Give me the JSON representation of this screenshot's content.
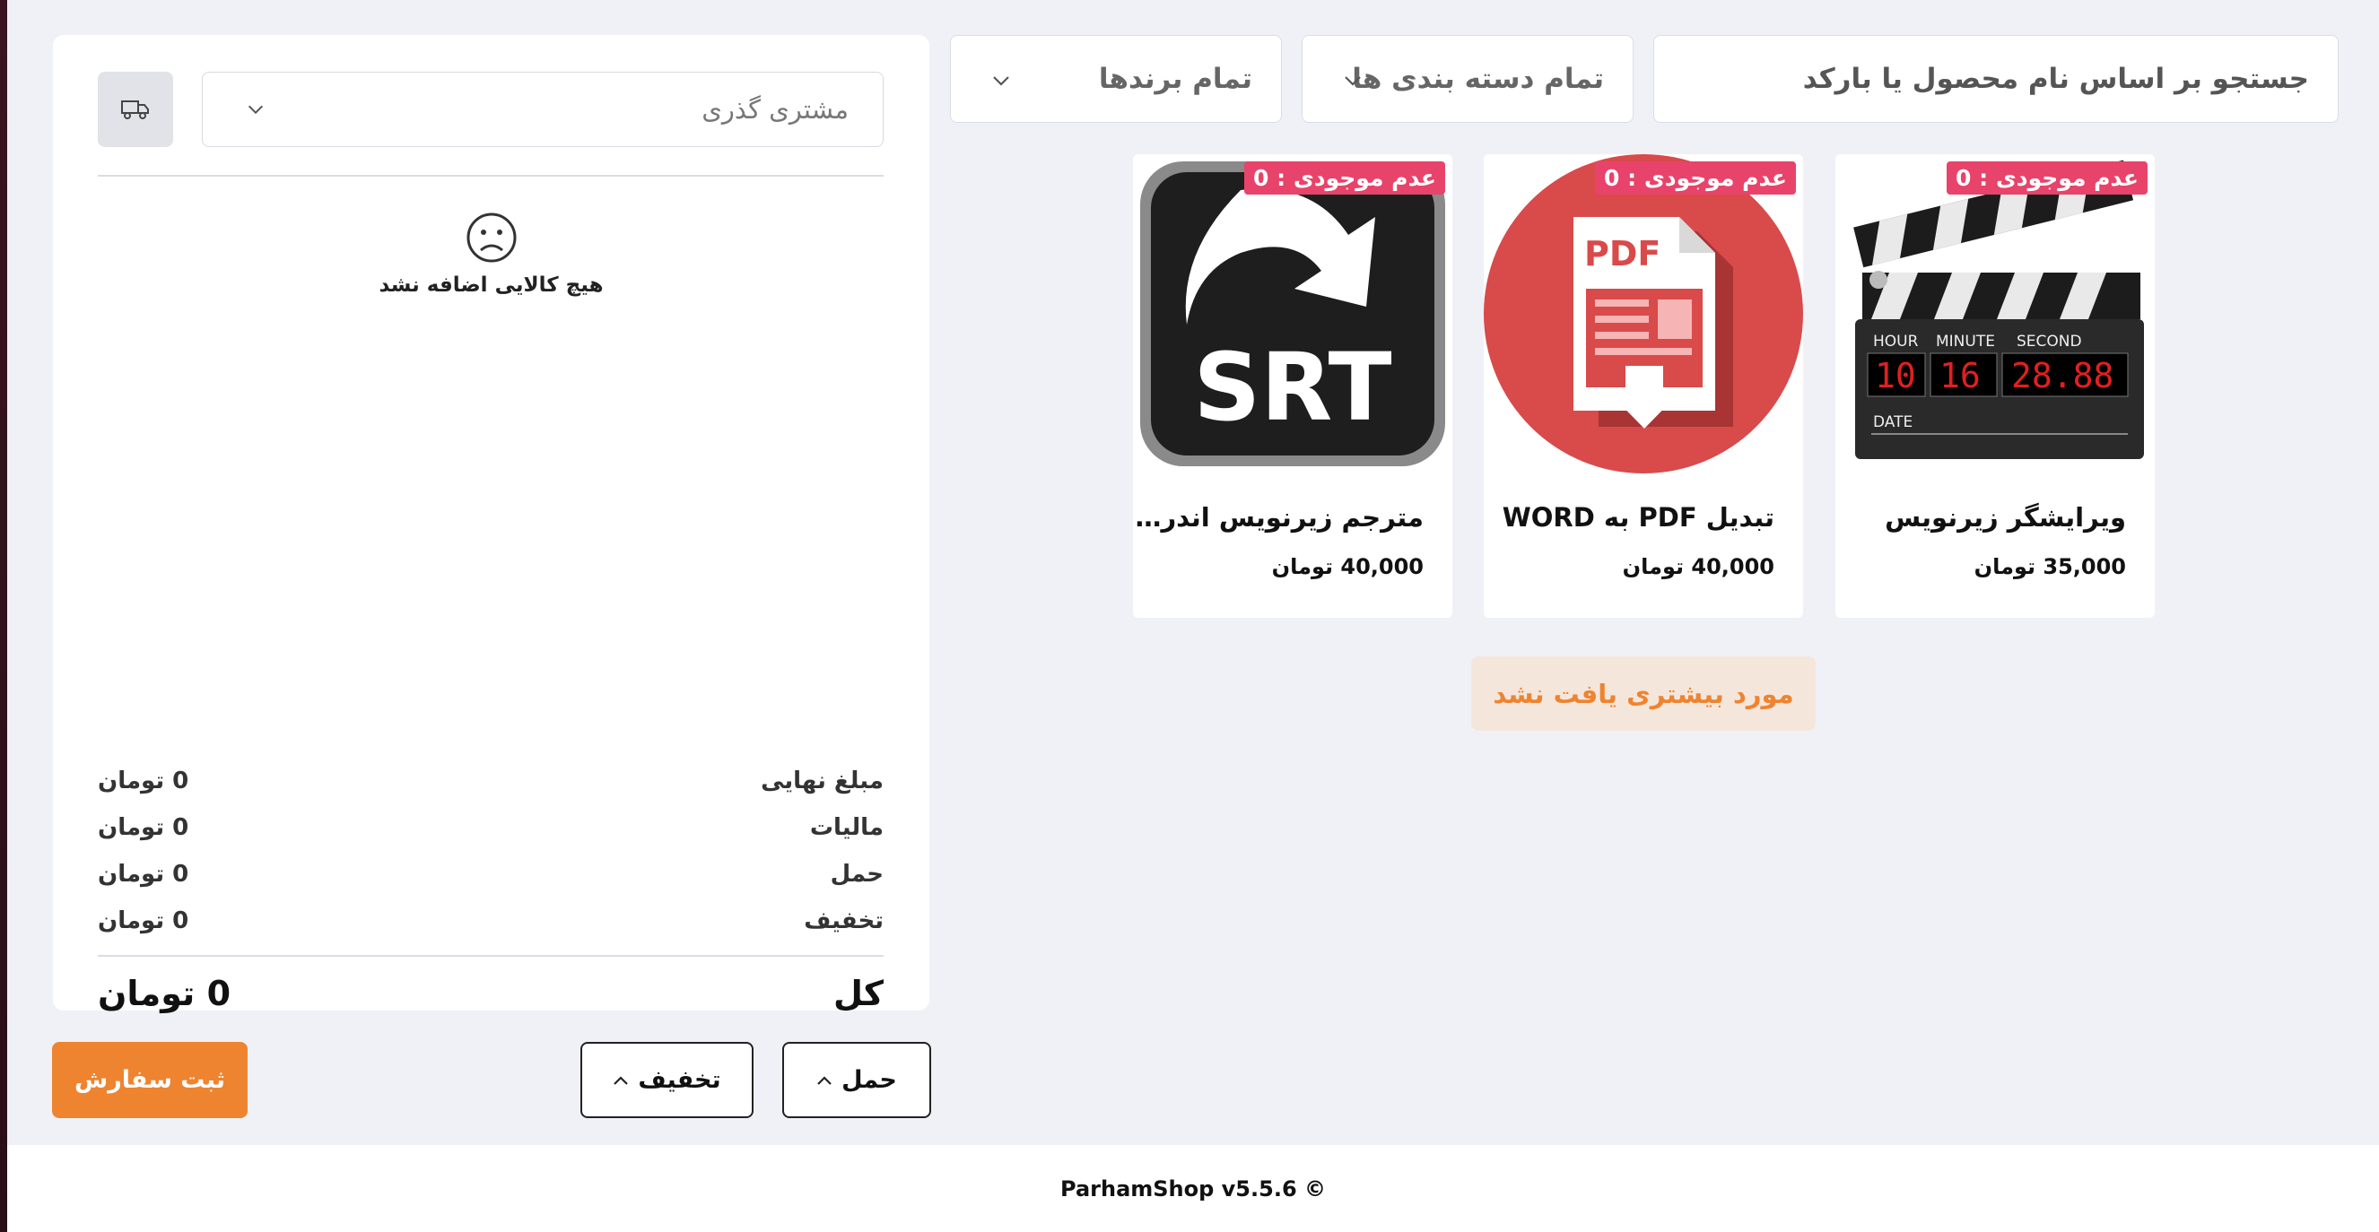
{
  "filters": {
    "search_placeholder": "جستجو بر اساس نام محصول یا بارکد",
    "category": "تمام دسته بندی ها",
    "brand": "تمام برندها"
  },
  "products": [
    {
      "name": "ویرایشگر زیرنویس",
      "price": "35,000 تومان",
      "badge": "عدم موجودی : 0",
      "icon": "clapperboard-icon"
    },
    {
      "name": "تبدیل PDF به WORD",
      "price": "40,000 تومان",
      "badge": "عدم موجودی : 0",
      "icon": "pdf-download-icon"
    },
    {
      "name": "مترجم زیرنویس اندر…",
      "price": "40,000 تومان",
      "badge": "عدم موجودی : 0",
      "icon": "srt-icon"
    }
  ],
  "product_thumbs": {
    "clapper": {
      "hour_label": "HOUR",
      "minute_label": "MINUTE",
      "second_label": "SECOND",
      "time_hh": "10",
      "time_mm": "16",
      "time_ss": "28.88",
      "date_label": "DATE"
    },
    "pdf": {
      "label": "PDF"
    },
    "srt": {
      "label": "SRT"
    }
  },
  "no_more_text": "مورد بیشتری یافت نشد",
  "cart": {
    "customer": "مشتری گذری",
    "empty_message": "هیچ کالایی اضافه نشد",
    "rows": [
      {
        "label": "مبلغ نهایی",
        "value": "0 تومان"
      },
      {
        "label": "مالیات",
        "value": "0 تومان"
      },
      {
        "label": "حمل",
        "value": "0 تومان"
      },
      {
        "label": "تخفیف",
        "value": "0 تومان"
      }
    ],
    "total_label": "کل",
    "total_value": "0 تومان"
  },
  "buttons": {
    "submit": "ثبت سفارش",
    "discount": "تخفیف",
    "shipping": "حمل"
  },
  "footer": "ParhamShop v5.5.6 ©",
  "colors": {
    "accent": "#ee8430",
    "badge": "#e8436a",
    "background": "#f0f1f7"
  }
}
